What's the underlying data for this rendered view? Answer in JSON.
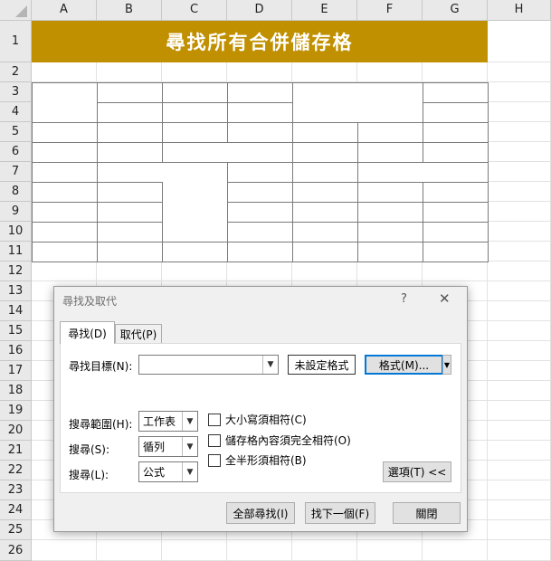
{
  "spreadsheet": {
    "columns": [
      "A",
      "B",
      "C",
      "D",
      "E",
      "F",
      "G",
      "H"
    ],
    "rows": [
      "1",
      "2",
      "3",
      "4",
      "5",
      "6",
      "7",
      "8",
      "9",
      "10",
      "11",
      "12",
      "13",
      "14",
      "15",
      "16",
      "17",
      "18",
      "19",
      "20",
      "21",
      "22",
      "23",
      "24",
      "25",
      "26"
    ],
    "title": "尋找所有合併儲存格",
    "title_color": "#c09000"
  },
  "dialog": {
    "title": "尋找及取代",
    "help_label": "?",
    "close_label": "✕",
    "tabs": [
      "尋找(D)",
      "取代(P)"
    ],
    "find_label": "尋找目標(N):",
    "find_value": "",
    "format_preview": "未設定格式",
    "format_button": "格式(M)...",
    "within_label": "搜尋範圍(H):",
    "within_value": "工作表",
    "search_label": "搜尋(S):",
    "search_value": "循列",
    "lookin_label": "搜尋(L):",
    "lookin_value": "公式",
    "match_case": "大小寫須相符(C)",
    "match_entire": "儲存格內容須完全相符(O)",
    "match_width": "全半形須相符(B)",
    "options_button": "選項(T) <<",
    "find_all_button": "全部尋找(I)",
    "find_next_button": "找下一個(F)",
    "close_button": "關閉"
  }
}
